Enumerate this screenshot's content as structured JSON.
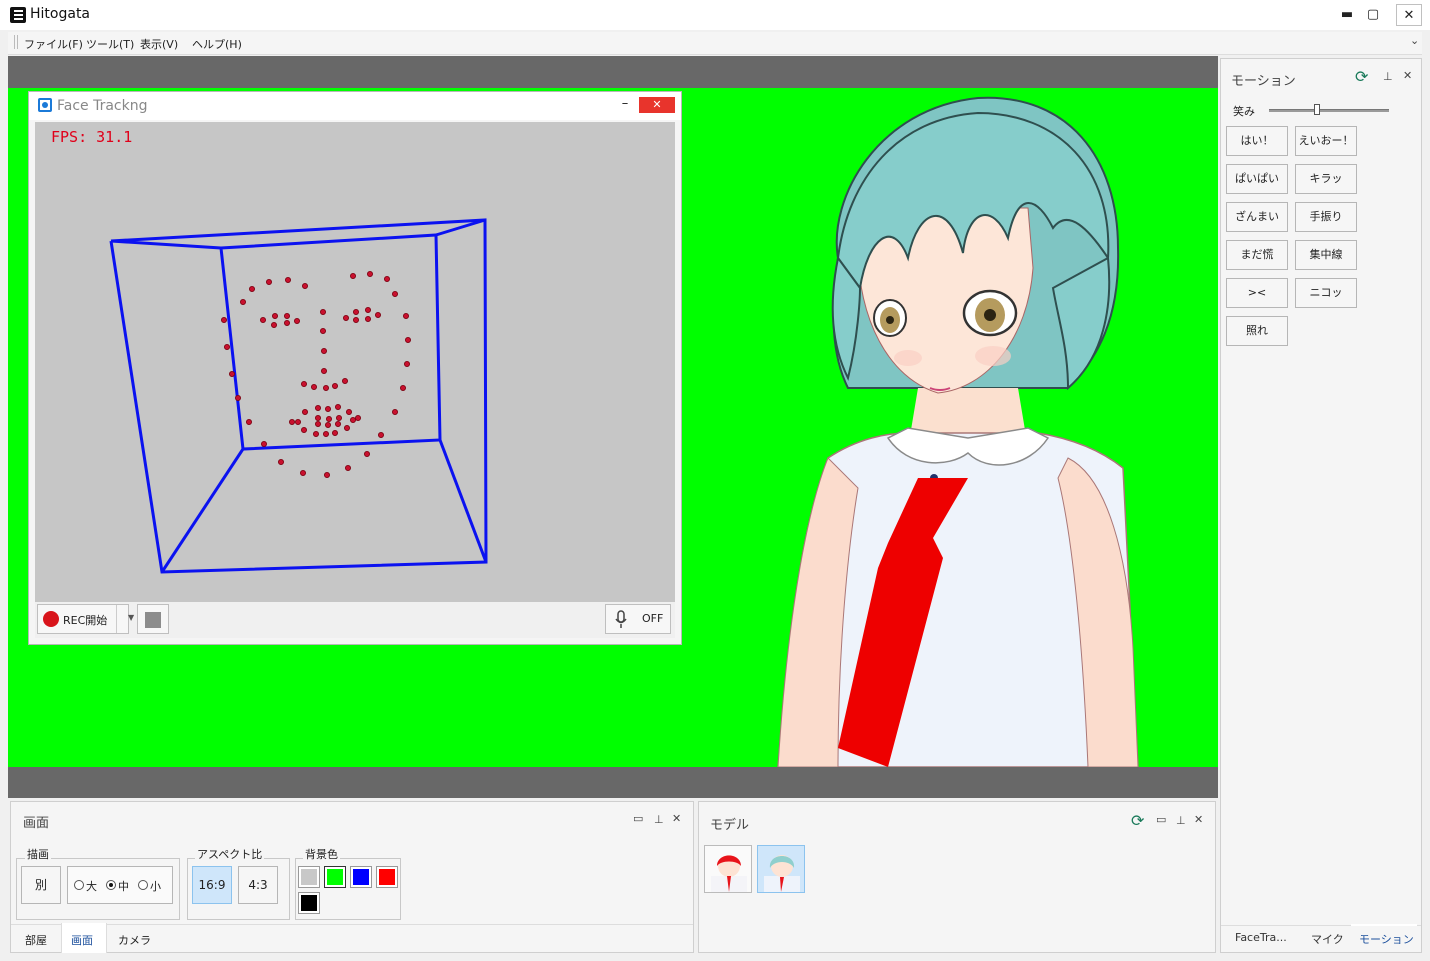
{
  "app": {
    "title": "Hitogata",
    "window_buttons": {
      "minimize": "▬",
      "maximize": "▢",
      "close": "✕"
    }
  },
  "menubar": {
    "items": [
      "ファイル(F)",
      "ツール(T)",
      "表示(V)",
      "ヘルプ(H)"
    ],
    "overflow_icon": "chevron-down-icon"
  },
  "viewport": {
    "background_color": "#00ff00",
    "letterbox_color": "#686868"
  },
  "face_tracking": {
    "title": "Face Trackng",
    "fps_text": "FPS:  31.1",
    "rec_label": "REC開始",
    "mic_state": "OFF",
    "close_glyph": "✕",
    "minimize_glyph": "–"
  },
  "motion_panel": {
    "title": "モーション",
    "slider_label": "笑み",
    "slider_value": 0.4,
    "buttons": [
      "はい！",
      "えいおー！",
      "ぱいぱい",
      "キラッ",
      "ざんまい",
      "手振り",
      "まだ慌",
      "集中線",
      "><",
      "ニコッ",
      "照れ"
    ],
    "tabs": [
      "FaceTra...",
      "マイク",
      "モーション"
    ],
    "active_tab": "モーション"
  },
  "screen_panel": {
    "title": "画面",
    "draw_group": {
      "label": "描画",
      "separate_button": "別",
      "size_options": [
        "大",
        "中",
        "小"
      ],
      "selected_size": "中"
    },
    "aspect_group": {
      "label": "アスペクト比",
      "options": [
        "16:9",
        "4:3"
      ],
      "selected": "16:9"
    },
    "bg_group": {
      "label": "背景色",
      "colors": [
        "#c8c8c8",
        "#00ff00",
        "#0000ff",
        "#ff0000",
        "#000000"
      ],
      "selected": "#00ff00"
    },
    "tabs": [
      "部屋",
      "画面",
      "カメラ"
    ],
    "active_tab": "画面"
  },
  "model_panel": {
    "title": "モデル",
    "models": [
      {
        "name": "red-hair-model",
        "hair_color": "#e8141b"
      },
      {
        "name": "teal-hair-model",
        "hair_color": "#8fcfcd"
      }
    ],
    "selected_index": 1
  }
}
